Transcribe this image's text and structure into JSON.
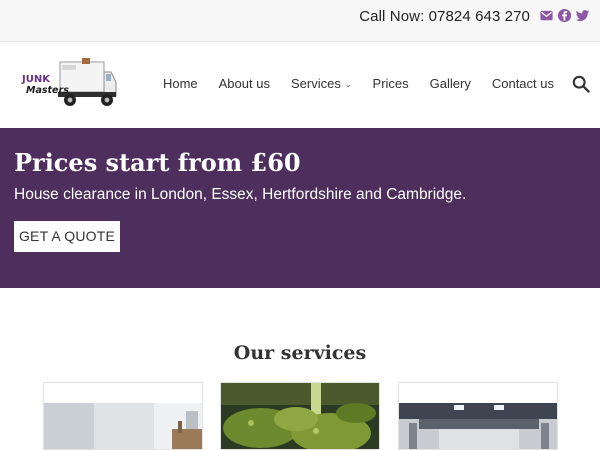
{
  "topbar": {
    "call_label": "Call Now: 07824 643 270",
    "social_icons": [
      "email-icon",
      "facebook-icon",
      "twitter-icon"
    ],
    "icon_color": "#8e57a6"
  },
  "header": {
    "logo_text_line1": "JUNK",
    "logo_text_line2": "Masters",
    "nav": [
      {
        "label": "Home"
      },
      {
        "label": "About us"
      },
      {
        "label": "Services",
        "has_dropdown": true
      },
      {
        "label": "Prices"
      },
      {
        "label": "Gallery"
      },
      {
        "label": "Contact us"
      }
    ],
    "search_icon": "search-icon"
  },
  "hero": {
    "title": "Prices start from £60",
    "subtitle": "House clearance in London, Essex, Hertfordshire and Cambridge.",
    "cta_label": "GET A QUOTE",
    "background": "#4d2e5c"
  },
  "services": {
    "title": "Our services",
    "cards": [
      {
        "image": "empty-room-photo"
      },
      {
        "image": "garden-plants-photo"
      },
      {
        "image": "office-ceiling-photo"
      }
    ]
  }
}
